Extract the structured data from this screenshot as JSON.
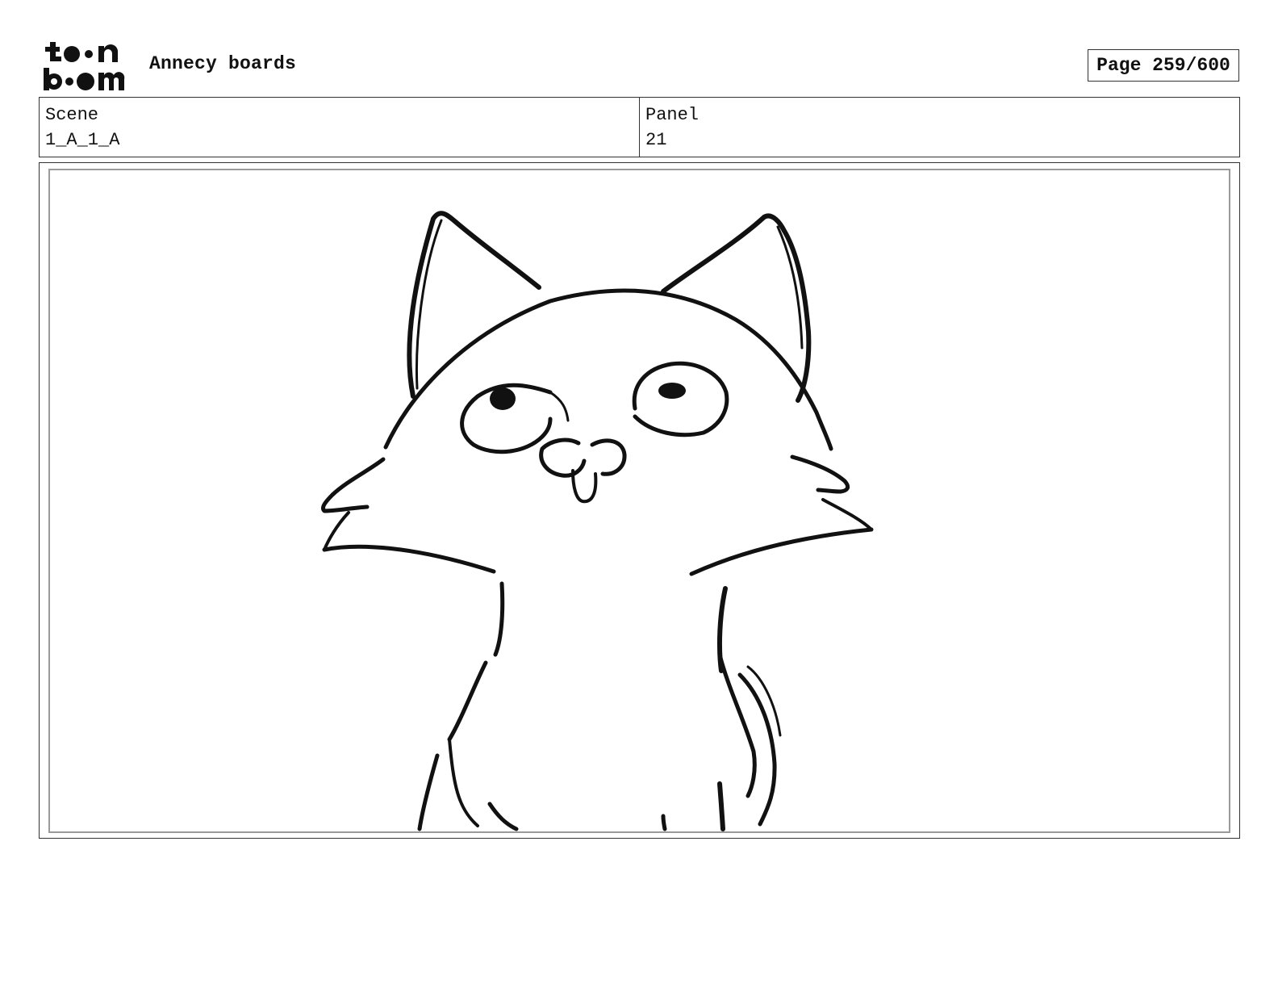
{
  "header": {
    "logo_text": "toon boom",
    "title": "Annecy boards",
    "page_label": "Page 259/600"
  },
  "info": {
    "scene_label": "Scene",
    "scene_value": "1_A_1_A",
    "panel_label": "Panel",
    "panel_value": "21"
  },
  "panel": {
    "drawing": "cat-sketch"
  }
}
